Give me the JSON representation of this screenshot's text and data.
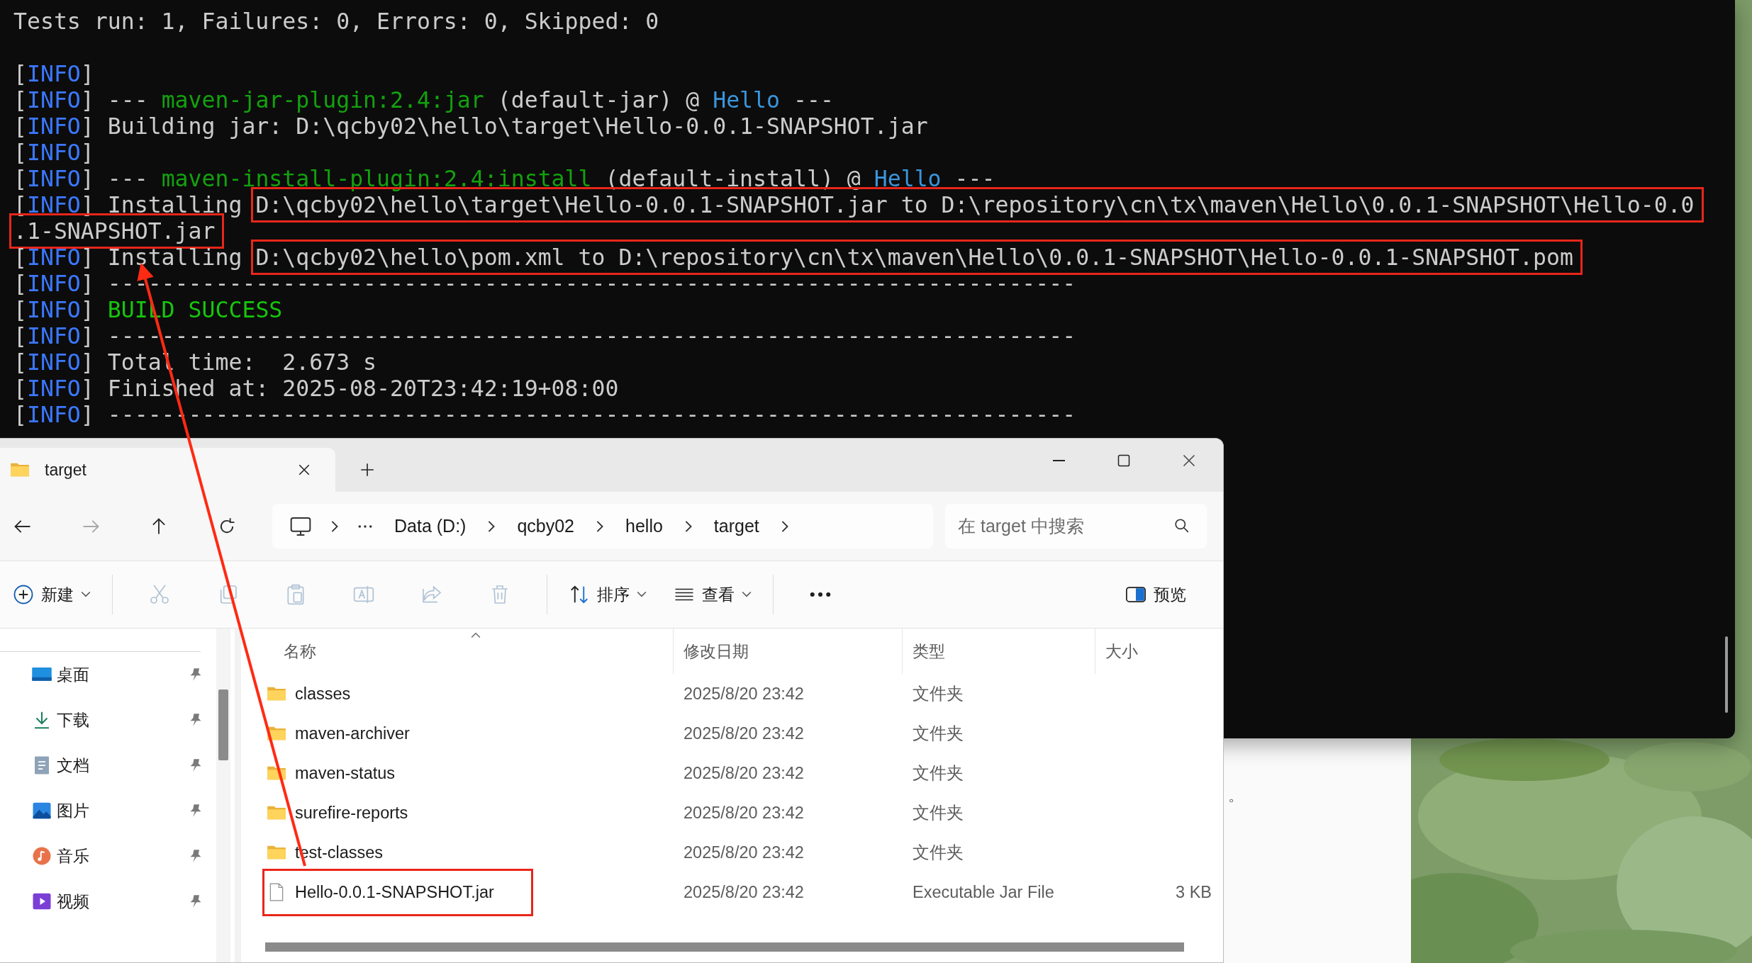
{
  "terminal": {
    "lines": [
      {
        "segments": [
          {
            "text": "Tests run: 1, Failures: 0, Errors: 0, Skipped: 0",
            "kind": "text",
            "highlighted": false
          }
        ]
      },
      {
        "blank": true
      },
      {
        "segments": [
          {
            "text": "[",
            "kind": "text",
            "highlighted": false
          },
          {
            "text": "INFO",
            "kind": "level",
            "highlighted": false
          },
          {
            "text": "]",
            "kind": "text",
            "highlighted": false
          }
        ]
      },
      {
        "segments": [
          {
            "text": "[",
            "kind": "text",
            "highlighted": false
          },
          {
            "text": "INFO",
            "kind": "level",
            "highlighted": false
          },
          {
            "text": "] --- ",
            "kind": "text",
            "highlighted": false
          },
          {
            "text": "maven-jar-plugin:2.4:jar",
            "kind": "plugin",
            "highlighted": false
          },
          {
            "text": " (default-jar) @ ",
            "kind": "text",
            "highlighted": false
          },
          {
            "text": "Hello",
            "kind": "project",
            "highlighted": false
          },
          {
            "text": " ---",
            "kind": "text",
            "highlighted": false
          }
        ]
      },
      {
        "segments": [
          {
            "text": "[",
            "kind": "text",
            "highlighted": false
          },
          {
            "text": "INFO",
            "kind": "level",
            "highlighted": false
          },
          {
            "text": "] Building jar: D:\\qcby02\\hello\\target\\Hello-0.0.1-SNAPSHOT.jar",
            "kind": "text",
            "highlighted": false
          }
        ]
      },
      {
        "segments": [
          {
            "text": "[",
            "kind": "text",
            "highlighted": false
          },
          {
            "text": "INFO",
            "kind": "level",
            "highlighted": false
          },
          {
            "text": "]",
            "kind": "text",
            "highlighted": false
          }
        ]
      },
      {
        "segments": [
          {
            "text": "[",
            "kind": "text",
            "highlighted": false
          },
          {
            "text": "INFO",
            "kind": "level",
            "highlighted": false
          },
          {
            "text": "] --- ",
            "kind": "text",
            "highlighted": false
          },
          {
            "text": "maven-install-plugin:2.4:install",
            "kind": "plugin",
            "highlighted": false
          },
          {
            "text": " (default-install) @ ",
            "kind": "text",
            "highlighted": false
          },
          {
            "text": "Hello",
            "kind": "project",
            "highlighted": false
          },
          {
            "text": " ---",
            "kind": "text",
            "highlighted": false
          }
        ]
      },
      {
        "segments": [
          {
            "text": "[",
            "kind": "text",
            "highlighted": false
          },
          {
            "text": "INFO",
            "kind": "level",
            "highlighted": false
          },
          {
            "text": "] Installing ",
            "kind": "text",
            "highlighted": false
          },
          {
            "text": "D:\\qcby02\\hello\\target\\Hello-0.0.1-SNAPSHOT.jar to D:\\repository\\cn\\tx\\maven\\Hello\\0.0.1-SNAPSHOT\\Hello-0.0",
            "kind": "text",
            "highlighted": true
          }
        ]
      },
      {
        "segments": [
          {
            "text": ".1-SNAPSHOT.jar",
            "kind": "text",
            "highlighted": true
          }
        ]
      },
      {
        "segments": [
          {
            "text": "[",
            "kind": "text",
            "highlighted": false
          },
          {
            "text": "INFO",
            "kind": "level",
            "highlighted": false
          },
          {
            "text": "] Installing ",
            "kind": "text",
            "highlighted": false
          },
          {
            "text": "D:\\qcby02\\hello\\pom.xml to D:\\repository\\cn\\tx\\maven\\Hello\\0.0.1-SNAPSHOT\\Hello-0.0.1-SNAPSHOT.pom",
            "kind": "text",
            "highlighted": true
          }
        ]
      },
      {
        "segments": [
          {
            "text": "[",
            "kind": "text",
            "highlighted": false
          },
          {
            "text": "INFO",
            "kind": "level",
            "highlighted": false
          },
          {
            "text": "] ------------------------------------------------------------------------",
            "kind": "text",
            "highlighted": false
          }
        ]
      },
      {
        "segments": [
          {
            "text": "[",
            "kind": "text",
            "highlighted": false
          },
          {
            "text": "INFO",
            "kind": "level",
            "highlighted": false
          },
          {
            "text": "] ",
            "kind": "text",
            "highlighted": false
          },
          {
            "text": "BUILD SUCCESS",
            "kind": "success",
            "highlighted": false
          }
        ]
      },
      {
        "segments": [
          {
            "text": "[",
            "kind": "text",
            "highlighted": false
          },
          {
            "text": "INFO",
            "kind": "level",
            "highlighted": false
          },
          {
            "text": "] ------------------------------------------------------------------------",
            "kind": "text",
            "highlighted": false
          }
        ]
      },
      {
        "segments": [
          {
            "text": "[",
            "kind": "text",
            "highlighted": false
          },
          {
            "text": "INFO",
            "kind": "level",
            "highlighted": false
          },
          {
            "text": "] Total time:  2.673 s",
            "kind": "text",
            "highlighted": false
          }
        ]
      },
      {
        "segments": [
          {
            "text": "[",
            "kind": "text",
            "highlighted": false
          },
          {
            "text": "INFO",
            "kind": "level",
            "highlighted": false
          },
          {
            "text": "] Finished at: 2025-08-20T23:42:19+08:00",
            "kind": "text",
            "highlighted": false
          }
        ]
      },
      {
        "segments": [
          {
            "text": "[",
            "kind": "text",
            "highlighted": false
          },
          {
            "text": "INFO",
            "kind": "level",
            "highlighted": false
          },
          {
            "text": "] ------------------------------------------------------------------------",
            "kind": "text",
            "highlighted": false
          }
        ]
      }
    ]
  },
  "background_document": {
    "text": "。"
  },
  "explorer": {
    "tab": {
      "title": "target"
    },
    "navigation": [
      {
        "kind": "back",
        "disabled": false
      },
      {
        "kind": "forward",
        "disabled": true
      },
      {
        "kind": "up",
        "disabled": false
      },
      {
        "kind": "refresh",
        "disabled": false
      }
    ],
    "breadcrumbs": [
      "Data (D:)",
      "qcby02",
      "hello",
      "target"
    ],
    "search": {
      "placeholder": "在 target 中搜索"
    },
    "commands": [
      {
        "kind": "new",
        "label": "新建",
        "disabled": false
      },
      {
        "kind": "separator"
      },
      {
        "kind": "cut",
        "disabled": true
      },
      {
        "kind": "copy",
        "disabled": true
      },
      {
        "kind": "paste",
        "disabled": true
      },
      {
        "kind": "rename",
        "disabled": true
      },
      {
        "kind": "share",
        "disabled": true
      },
      {
        "kind": "delete",
        "disabled": true
      },
      {
        "kind": "separator"
      },
      {
        "kind": "sort",
        "label": "排序",
        "disabled": false
      },
      {
        "kind": "view",
        "label": "查看",
        "disabled": false
      },
      {
        "kind": "separator"
      },
      {
        "kind": "more",
        "disabled": false
      }
    ],
    "preview": {
      "label": "预览"
    },
    "sidebar": [
      {
        "kind": "desktop",
        "label": "桌面",
        "pinned": true
      },
      {
        "kind": "downloads",
        "label": "下载",
        "pinned": true
      },
      {
        "kind": "documents",
        "label": "文档",
        "pinned": true
      },
      {
        "kind": "pictures",
        "label": "图片",
        "pinned": true
      },
      {
        "kind": "music",
        "label": "音乐",
        "pinned": true
      },
      {
        "kind": "videos",
        "label": "视频",
        "pinned": true
      }
    ],
    "columns": [
      "名称",
      "修改日期",
      "类型",
      "大小"
    ],
    "files": [
      {
        "kind": "folder",
        "name": "classes",
        "modified": "2025/8/20 23:42",
        "type": "文件夹",
        "highlighted": false
      },
      {
        "kind": "folder",
        "name": "maven-archiver",
        "modified": "2025/8/20 23:42",
        "type": "文件夹",
        "highlighted": false
      },
      {
        "kind": "folder",
        "name": "maven-status",
        "modified": "2025/8/20 23:42",
        "type": "文件夹",
        "highlighted": false
      },
      {
        "kind": "folder",
        "name": "surefire-reports",
        "modified": "2025/8/20 23:42",
        "type": "文件夹",
        "highlighted": false
      },
      {
        "kind": "folder",
        "name": "test-classes",
        "modified": "2025/8/20 23:42",
        "type": "文件夹",
        "highlighted": false
      },
      {
        "kind": "file",
        "name": "Hello-0.0.1-SNAPSHOT.jar",
        "modified": "2025/8/20 23:42",
        "type": "Executable Jar File",
        "size": "3 KB",
        "highlighted": true
      }
    ]
  }
}
